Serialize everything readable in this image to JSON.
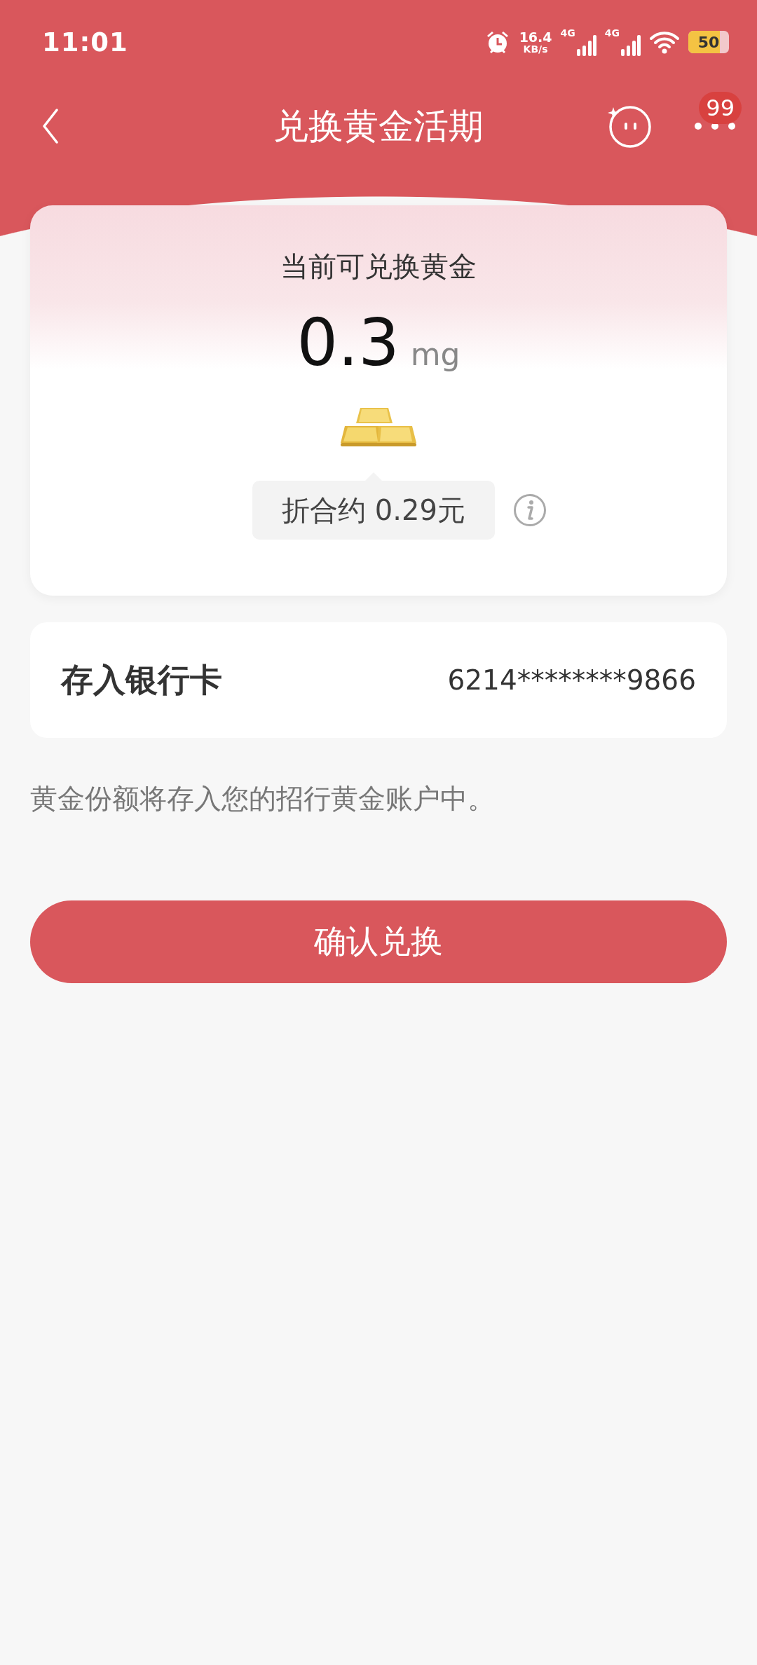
{
  "status_bar": {
    "time": "11:01",
    "net_speed": "16.4",
    "net_speed_unit": "KB/s",
    "networks": [
      "4G",
      "4G"
    ],
    "battery": "50"
  },
  "nav": {
    "title": "兑换黄金活期",
    "badge": "99"
  },
  "gold": {
    "label": "当前可兑换黄金",
    "amount": "0.3",
    "unit": "mg",
    "equivalent": "折合约 0.29元"
  },
  "bank_card": {
    "label": "存入银行卡",
    "number": "6214********9866"
  },
  "note": "黄金份额将存入您的招行黄金账户中。",
  "confirm_button": "确认兑换"
}
